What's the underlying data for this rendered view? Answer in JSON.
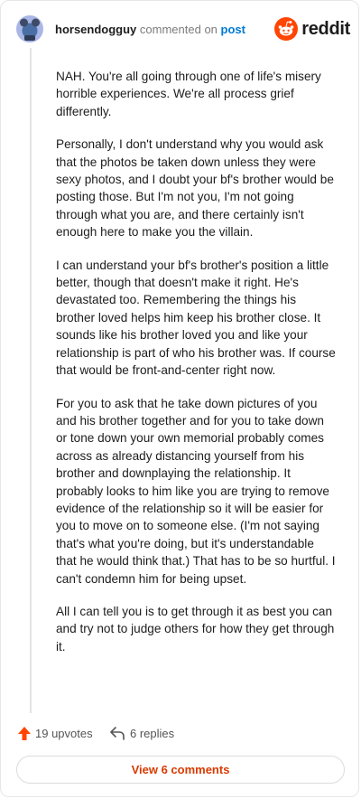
{
  "header": {
    "username": "horsendogguy",
    "commented_text": "commented on",
    "post_link": "post",
    "brand": "reddit"
  },
  "comment": {
    "paragraphs": [
      "NAH. You're all going through one of life's misery horrible experiences. We're all process grief differently.",
      "Personally, I don't understand why you would ask that the photos be taken down unless they were sexy photos, and I doubt your bf's brother would be posting those. But I'm not you, I'm not going through what you are, and there certainly isn't enough here to make you the villain.",
      "I can understand your bf's brother's position a little better, though that doesn't make it right. He's devastated too. Remembering the things his brother loved helps him keep his brother close. It sounds like his brother loved you and like your relationship is part of who his brother was. If course that would be front-and-center right now.",
      "For you to ask that he take down pictures of you and his brother together and for you to take down or tone down your own memorial probably comes across as already distancing yourself from his brother and downplaying the relationship. It probably looks to him like you are trying to remove evidence of the relationship so it will be easier for you to move on to someone else. (I'm not saying that's what you're doing, but it's understandable that he would think that.) That has to be so hurtful. I can't condemn him for being upset.",
      "All I can tell you is to get through it as best you can and try not to judge others for how they get through it."
    ]
  },
  "footer": {
    "upvotes": "19 upvotes",
    "replies": "6 replies",
    "view_comments": "View 6 comments"
  },
  "colors": {
    "accent": "#ff4500",
    "link": "#0079d3",
    "view_button_text": "#d93a00"
  },
  "icons": {
    "avatar": "avatar-icon",
    "brand": "reddit-logo-icon",
    "upvote": "upvote-arrow-icon",
    "reply": "reply-arrow-icon"
  }
}
